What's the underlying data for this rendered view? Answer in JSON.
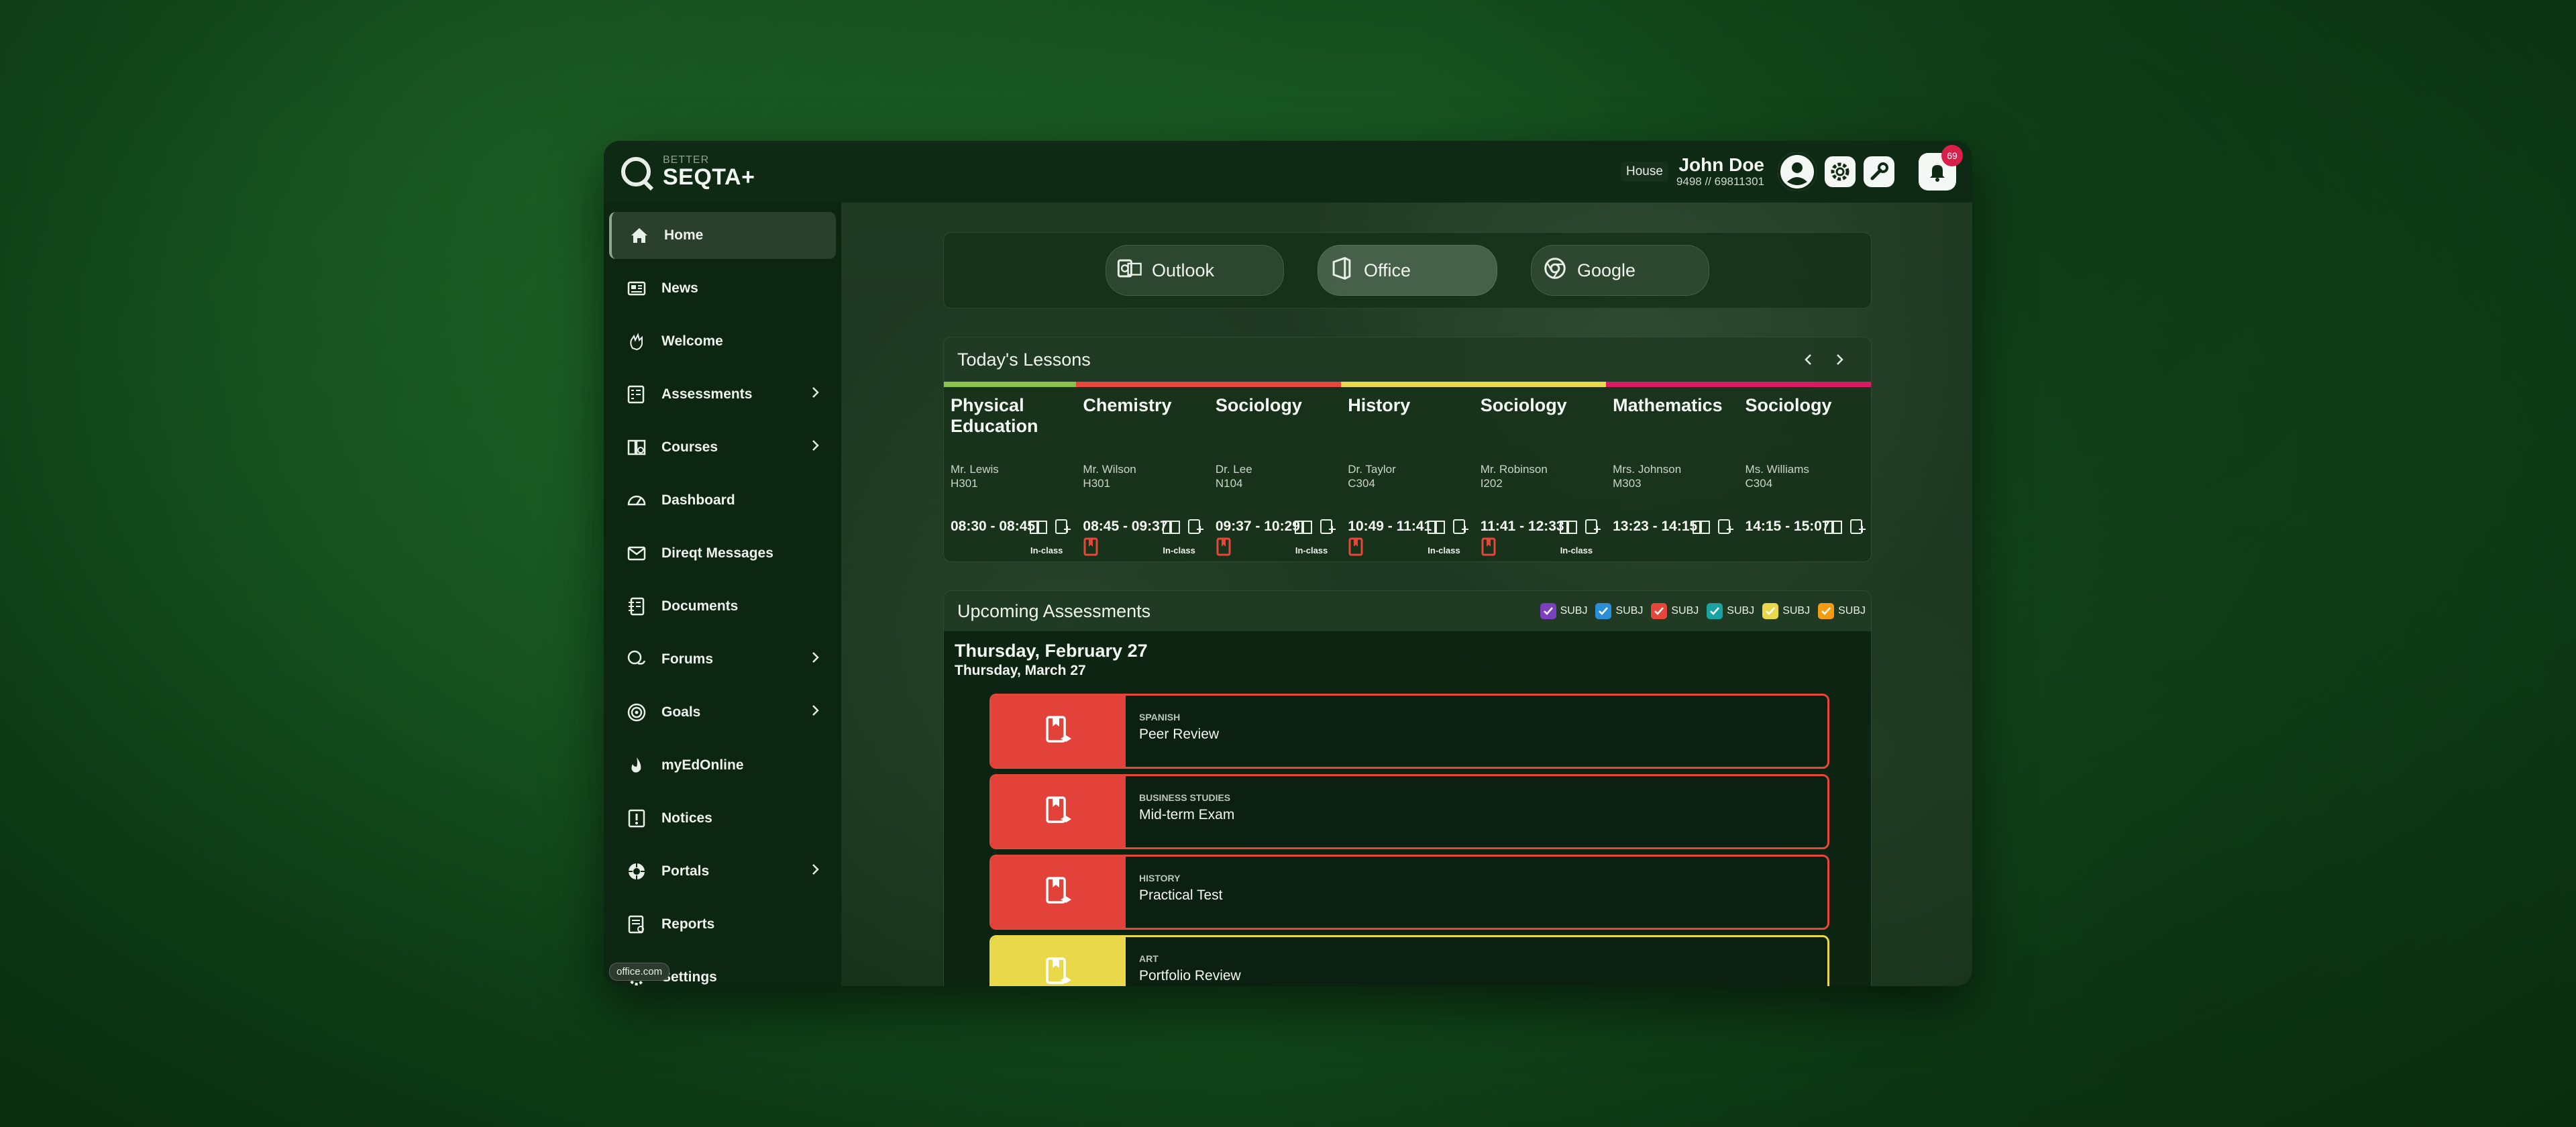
{
  "brand": {
    "small": "BETTER",
    "name": "SEQTA+"
  },
  "user": {
    "house": "House",
    "name": "John Doe",
    "id": "9498 // 69811301",
    "notifications": "69"
  },
  "sidebar": {
    "items": [
      {
        "label": "Home",
        "icon": "home-icon",
        "chevron": false,
        "active": true
      },
      {
        "label": "News",
        "icon": "news-icon",
        "chevron": false
      },
      {
        "label": "Welcome",
        "icon": "welcome-hand-icon",
        "chevron": false
      },
      {
        "label": "Assessments",
        "icon": "assessments-icon",
        "chevron": true
      },
      {
        "label": "Courses",
        "icon": "courses-icon",
        "chevron": true
      },
      {
        "label": "Dashboard",
        "icon": "dashboard-icon",
        "chevron": false
      },
      {
        "label": "Direqt Messages",
        "icon": "messages-icon",
        "chevron": false
      },
      {
        "label": "Documents",
        "icon": "documents-icon",
        "chevron": false
      },
      {
        "label": "Forums",
        "icon": "forums-icon",
        "chevron": true
      },
      {
        "label": "Goals",
        "icon": "goals-icon",
        "chevron": true
      },
      {
        "label": "myEdOnline",
        "icon": "myedonline-icon",
        "chevron": false
      },
      {
        "label": "Notices",
        "icon": "notices-icon",
        "chevron": false
      },
      {
        "label": "Portals",
        "icon": "portals-icon",
        "chevron": true
      },
      {
        "label": "Reports",
        "icon": "reports-icon",
        "chevron": false
      },
      {
        "label": "Settings",
        "icon": "settings-icon",
        "chevron": false
      }
    ],
    "tooltip": "office.com"
  },
  "quicklinks": [
    {
      "label": "Outlook",
      "icon": "outlook-icon"
    },
    {
      "label": "Office",
      "icon": "office-icon"
    },
    {
      "label": "Google",
      "icon": "google-icon"
    }
  ],
  "lessons": {
    "title": "Today's Lessons",
    "colors": [
      "#8bc34a",
      "#e5473a",
      "#e5473a",
      "#e8d84a",
      "#e8d84a",
      "#d81b60",
      "#d81b60"
    ],
    "items": [
      {
        "subject": "Physical Education",
        "teacher": "Mr. Lewis",
        "room": "H301",
        "time": "08:30 - 08:45",
        "inclass": "In-class",
        "flag": false
      },
      {
        "subject": "Chemistry",
        "teacher": "Mr. Wilson",
        "room": "H301",
        "time": "08:45 - 09:37",
        "inclass": "In-class",
        "flag": true
      },
      {
        "subject": "Sociology",
        "teacher": "Dr. Lee",
        "room": "N104",
        "time": "09:37 - 10:29",
        "inclass": "In-class",
        "flag": true
      },
      {
        "subject": "History",
        "teacher": "Dr. Taylor",
        "room": "C304",
        "time": "10:49 - 11:41",
        "inclass": "In-class",
        "flag": true
      },
      {
        "subject": "Sociology",
        "teacher": "Mr. Robinson",
        "room": "I202",
        "time": "11:41 - 12:33",
        "inclass": "In-class",
        "flag": true
      },
      {
        "subject": "Mathematics",
        "teacher": "Mrs. Johnson",
        "room": "M303",
        "time": "13:23 - 14:15",
        "inclass": "",
        "flag": false
      },
      {
        "subject": "Sociology",
        "teacher": "Ms. Williams",
        "room": "C304",
        "time": "14:15 - 15:07",
        "inclass": "",
        "flag": false
      }
    ]
  },
  "assessments": {
    "title": "Upcoming Assessments",
    "filters": [
      {
        "label": "SUBJ",
        "color": "#7b3fbf"
      },
      {
        "label": "SUBJ",
        "color": "#2b8fd8"
      },
      {
        "label": "SUBJ",
        "color": "#e5473a"
      },
      {
        "label": "SUBJ",
        "color": "#1aa3a3"
      },
      {
        "label": "SUBJ",
        "color": "#e8d84a"
      },
      {
        "label": "SUBJ",
        "color": "#f39c12"
      }
    ],
    "date_primary": "Thursday, February 27",
    "date_secondary": "Thursday, March 27",
    "items": [
      {
        "subject": "SPANISH",
        "title": "Peer Review",
        "color": "red"
      },
      {
        "subject": "BUSINESS STUDIES",
        "title": "Mid-term Exam",
        "color": "red"
      },
      {
        "subject": "HISTORY",
        "title": "Practical Test",
        "color": "red"
      },
      {
        "subject": "ART",
        "title": "Portfolio Review",
        "color": "yellow"
      }
    ]
  }
}
